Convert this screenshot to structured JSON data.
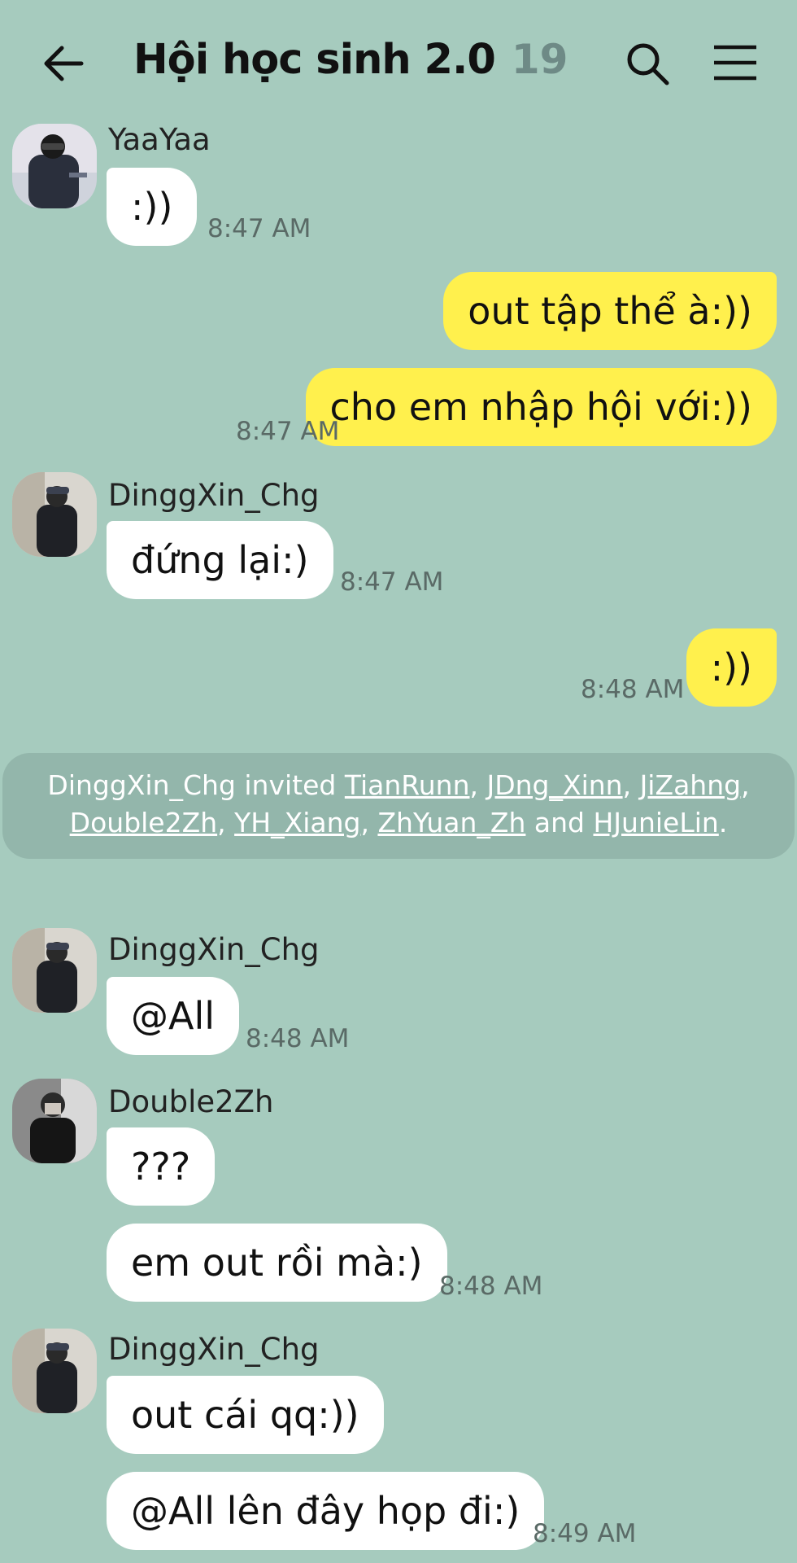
{
  "header": {
    "title": "Hội học sinh 2.0",
    "member_count": "19",
    "back_icon": "arrow-left-icon",
    "search_icon": "search-icon",
    "menu_icon": "hamburger-menu-icon"
  },
  "colors": {
    "background": "#a6cbbe",
    "my_bubble": "#fff04d",
    "their_bubble": "#ffffff",
    "system_notice": "#93b6ab"
  },
  "messages": {
    "m1": {
      "sender": "YaaYaa",
      "text": ":))",
      "time": "8:47 AM"
    },
    "m2": {
      "text": "out tập thể à:))"
    },
    "m3": {
      "text": "cho em nhập hội với:))",
      "time": "8:47 AM"
    },
    "m4": {
      "sender": "DinggXin_Chg",
      "text": "đứng lại:)",
      "time": "8:47 AM"
    },
    "m5": {
      "text": ":))",
      "time": "8:48 AM"
    },
    "m6": {
      "sender": "DinggXin_Chg",
      "text": "@All",
      "time": "8:48 AM"
    },
    "m7": {
      "sender": "Double2Zh",
      "text": "???"
    },
    "m8": {
      "text": "em out rồi mà:)",
      "time": "8:48 AM"
    },
    "m9": {
      "sender": "DinggXin_Chg",
      "text": "out cái qq:))"
    },
    "m10": {
      "text": "@All lên đây họp đi:)",
      "time": "8:49 AM"
    }
  },
  "system_notice": {
    "inviter": "DinggXin_Chg",
    "verb": " invited ",
    "invitees": [
      "TianRunn",
      "JDng_Xinn",
      "JiZahng",
      "Double2Zh",
      "YH_Xiang",
      "ZhYuan_Zh",
      "HJunieLin"
    ],
    "sep": ", ",
    "and": " and ",
    "end": "."
  }
}
